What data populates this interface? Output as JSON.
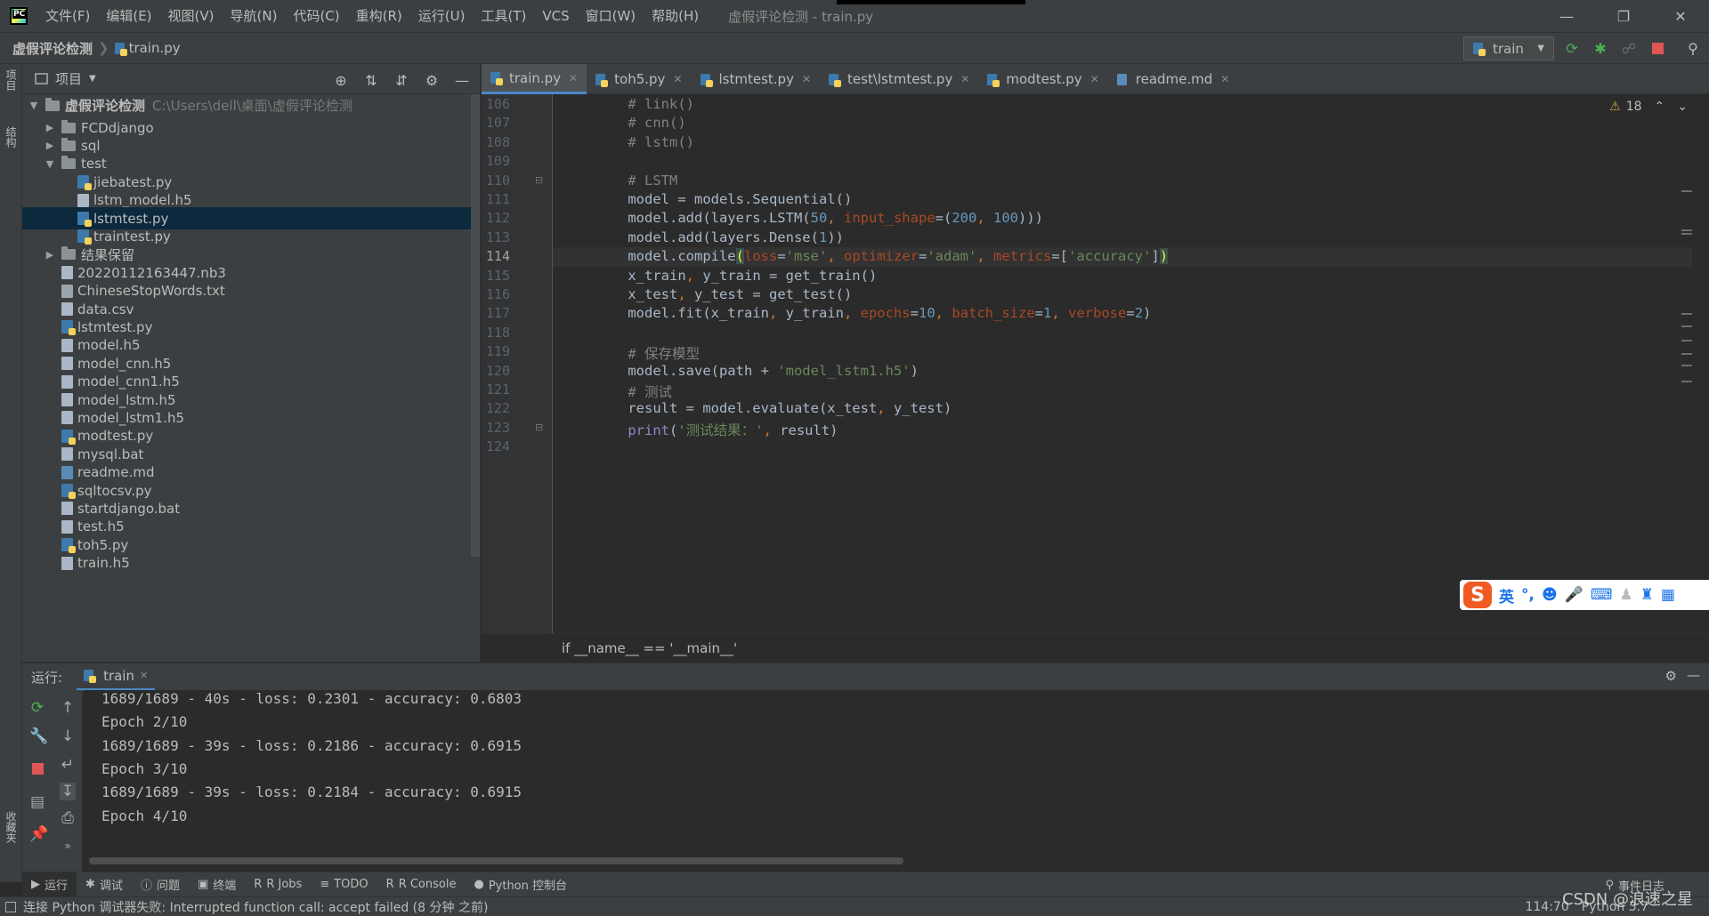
{
  "menubar": {
    "items": [
      "文件(F)",
      "编辑(E)",
      "视图(V)",
      "导航(N)",
      "代码(C)",
      "重构(R)",
      "运行(U)",
      "工具(T)",
      "VCS",
      "窗口(W)",
      "帮助(H)"
    ],
    "window_title": "虚假评论检测 - train.py"
  },
  "navbar": {
    "breadcrumb": [
      "虚假评论检测",
      "train.py"
    ],
    "run_config": "train"
  },
  "left_strip": {
    "project_tab": "项目",
    "structure_tab": "结构",
    "favorites_tab": "收藏夹"
  },
  "project_panel": {
    "title": "项目",
    "root_name": "虚假评论检测",
    "root_path": "C:\\Users\\dell\\桌面\\虚假评论检测",
    "items": [
      {
        "name": "FCDdjango",
        "type": "folder",
        "depth": 1,
        "arrow": "▶"
      },
      {
        "name": "sql",
        "type": "folder",
        "depth": 1,
        "arrow": "▶"
      },
      {
        "name": "test",
        "type": "folder",
        "depth": 1,
        "arrow": "▼"
      },
      {
        "name": "jiebatest.py",
        "type": "py",
        "depth": 2,
        "arrow": ""
      },
      {
        "name": "lstm_model.h5",
        "type": "file",
        "depth": 2,
        "arrow": ""
      },
      {
        "name": "lstmtest.py",
        "type": "py",
        "depth": 2,
        "arrow": "",
        "selected": true
      },
      {
        "name": "traintest.py",
        "type": "py",
        "depth": 2,
        "arrow": ""
      },
      {
        "name": "结果保留",
        "type": "folder",
        "depth": 1,
        "arrow": "▶"
      },
      {
        "name": "20220112163447.nb3",
        "type": "file",
        "depth": 1,
        "arrow": ""
      },
      {
        "name": "ChineseStopWords.txt",
        "type": "txt",
        "depth": 1,
        "arrow": ""
      },
      {
        "name": "data.csv",
        "type": "file",
        "depth": 1,
        "arrow": ""
      },
      {
        "name": "lstmtest.py",
        "type": "py",
        "depth": 1,
        "arrow": ""
      },
      {
        "name": "model.h5",
        "type": "file",
        "depth": 1,
        "arrow": ""
      },
      {
        "name": "model_cnn.h5",
        "type": "file",
        "depth": 1,
        "arrow": ""
      },
      {
        "name": "model_cnn1.h5",
        "type": "file",
        "depth": 1,
        "arrow": ""
      },
      {
        "name": "model_lstm.h5",
        "type": "file",
        "depth": 1,
        "arrow": ""
      },
      {
        "name": "model_lstm1.h5",
        "type": "file",
        "depth": 1,
        "arrow": ""
      },
      {
        "name": "modtest.py",
        "type": "py",
        "depth": 1,
        "arrow": ""
      },
      {
        "name": "mysql.bat",
        "type": "file",
        "depth": 1,
        "arrow": ""
      },
      {
        "name": "readme.md",
        "type": "md",
        "depth": 1,
        "arrow": ""
      },
      {
        "name": "sqltocsv.py",
        "type": "py",
        "depth": 1,
        "arrow": ""
      },
      {
        "name": "startdjango.bat",
        "type": "file",
        "depth": 1,
        "arrow": ""
      },
      {
        "name": "test.h5",
        "type": "file",
        "depth": 1,
        "arrow": ""
      },
      {
        "name": "toh5.py",
        "type": "py",
        "depth": 1,
        "arrow": ""
      },
      {
        "name": "train.h5",
        "type": "file",
        "depth": 1,
        "arrow": ""
      }
    ]
  },
  "editor": {
    "tabs": [
      {
        "label": "train.py",
        "active": true
      },
      {
        "label": "toh5.py",
        "active": false
      },
      {
        "label": "lstmtest.py",
        "active": false
      },
      {
        "label": "test\\lstmtest.py",
        "active": false
      },
      {
        "label": "modtest.py",
        "active": false
      },
      {
        "label": "readme.md",
        "active": false
      }
    ],
    "inspection_count": "18",
    "current_line": 114,
    "lines": [
      {
        "no": "106",
        "tokens": [
          {
            "t": "    # link()",
            "c": "c-comment"
          }
        ]
      },
      {
        "no": "107",
        "tokens": [
          {
            "t": "    # cnn()",
            "c": "c-comment"
          }
        ]
      },
      {
        "no": "108",
        "tokens": [
          {
            "t": "    # lstm()",
            "c": "c-comment"
          }
        ]
      },
      {
        "no": "109",
        "tokens": []
      },
      {
        "no": "110",
        "tokens": [
          {
            "t": "    # LSTM",
            "c": "c-comment"
          }
        ]
      },
      {
        "no": "111",
        "tokens": [
          {
            "t": "    model = models.Sequential()",
            "c": ""
          }
        ]
      },
      {
        "no": "112",
        "tokens": [
          {
            "t": "    model.add(layers.LSTM(",
            "c": ""
          },
          {
            "t": "50",
            "c": "c-num"
          },
          {
            "t": ", ",
            "c": "c-kw"
          },
          {
            "t": "input_shape",
            "c": "c-param"
          },
          {
            "t": "=(",
            "c": ""
          },
          {
            "t": "200",
            "c": "c-num"
          },
          {
            "t": ", ",
            "c": "c-kw"
          },
          {
            "t": "100",
            "c": "c-num"
          },
          {
            "t": ")))",
            "c": ""
          }
        ]
      },
      {
        "no": "113",
        "tokens": [
          {
            "t": "    model.add(layers.Dense(",
            "c": ""
          },
          {
            "t": "1",
            "c": "c-num"
          },
          {
            "t": "))",
            "c": ""
          }
        ]
      },
      {
        "no": "114",
        "tokens": [
          {
            "t": "    model.compile",
            "c": ""
          },
          {
            "t": "(",
            "c": "c-paren-hl"
          },
          {
            "t": "loss",
            "c": "c-param"
          },
          {
            "t": "=",
            "c": ""
          },
          {
            "t": "'mse'",
            "c": "c-str"
          },
          {
            "t": ", ",
            "c": "c-kw"
          },
          {
            "t": "optimizer",
            "c": "c-param"
          },
          {
            "t": "=",
            "c": ""
          },
          {
            "t": "'adam'",
            "c": "c-str"
          },
          {
            "t": ", ",
            "c": "c-kw"
          },
          {
            "t": "metrics",
            "c": "c-param"
          },
          {
            "t": "=[",
            "c": ""
          },
          {
            "t": "'accuracy'",
            "c": "c-str"
          },
          {
            "t": "]",
            "c": ""
          },
          {
            "t": ")",
            "c": "c-paren-hl"
          }
        ]
      },
      {
        "no": "115",
        "tokens": [
          {
            "t": "    x_train",
            "c": ""
          },
          {
            "t": ", ",
            "c": "c-kw"
          },
          {
            "t": "y_train = get_train()",
            "c": ""
          }
        ]
      },
      {
        "no": "116",
        "tokens": [
          {
            "t": "    x_test",
            "c": ""
          },
          {
            "t": ", ",
            "c": "c-kw"
          },
          {
            "t": "y_test = get_test()",
            "c": ""
          }
        ]
      },
      {
        "no": "117",
        "tokens": [
          {
            "t": "    model.fit(x_train",
            "c": ""
          },
          {
            "t": ", ",
            "c": "c-kw"
          },
          {
            "t": "y_train",
            "c": ""
          },
          {
            "t": ", ",
            "c": "c-kw"
          },
          {
            "t": "epochs",
            "c": "c-param"
          },
          {
            "t": "=",
            "c": ""
          },
          {
            "t": "10",
            "c": "c-num"
          },
          {
            "t": ", ",
            "c": "c-kw"
          },
          {
            "t": "batch_size",
            "c": "c-param"
          },
          {
            "t": "=",
            "c": ""
          },
          {
            "t": "1",
            "c": "c-num"
          },
          {
            "t": ", ",
            "c": "c-kw"
          },
          {
            "t": "verbose",
            "c": "c-param"
          },
          {
            "t": "=",
            "c": ""
          },
          {
            "t": "2",
            "c": "c-num"
          },
          {
            "t": ")",
            "c": ""
          }
        ]
      },
      {
        "no": "118",
        "tokens": []
      },
      {
        "no": "119",
        "tokens": [
          {
            "t": "    # 保存模型",
            "c": "c-comment"
          }
        ]
      },
      {
        "no": "120",
        "tokens": [
          {
            "t": "    model.save(path + ",
            "c": ""
          },
          {
            "t": "'model_lstm1.h5'",
            "c": "c-str"
          },
          {
            "t": ")",
            "c": ""
          }
        ]
      },
      {
        "no": "121",
        "tokens": [
          {
            "t": "    # 测试",
            "c": "c-comment"
          }
        ]
      },
      {
        "no": "122",
        "tokens": [
          {
            "t": "    result = model.evaluate(x_test",
            "c": ""
          },
          {
            "t": ", ",
            "c": "c-kw"
          },
          {
            "t": "y_test)",
            "c": ""
          }
        ]
      },
      {
        "no": "123",
        "tokens": [
          {
            "t": "    ",
            "c": ""
          },
          {
            "t": "print",
            "c": "c-builtin"
          },
          {
            "t": "(",
            "c": ""
          },
          {
            "t": "'测试结果：'",
            "c": "c-str"
          },
          {
            "t": ", ",
            "c": "c-kw"
          },
          {
            "t": "result)",
            "c": ""
          }
        ]
      },
      {
        "no": "124",
        "tokens": []
      }
    ],
    "bottom_breadcrumb": "if __name__ == '__main__'"
  },
  "ime": {
    "lang": "英",
    "punct": "°,"
  },
  "run_panel": {
    "label": "运行:",
    "tab": "train",
    "console_lines": [
      "1689/1689 - 40s - loss: 0.2301 - accuracy: 0.6803",
      "Epoch 2/10",
      "1689/1689 - 39s - loss: 0.2186 - accuracy: 0.6915",
      "Epoch 3/10",
      "1689/1689 - 39s - loss: 0.2184 - accuracy: 0.6915",
      "Epoch 4/10"
    ]
  },
  "tool_tabs": {
    "items": [
      "运行",
      "调试",
      "问题",
      "终端",
      "R Jobs",
      "TODO",
      "R Console",
      "Python 控制台"
    ],
    "event_log": "事件日志"
  },
  "statusbar": {
    "message": "连接 Python 调试器失败: Interrupted function call: accept failed (8 分钟 之前)",
    "position": "114:70",
    "interpreter": "Python 3.7",
    "watermark": "CSDN @浪速之星"
  },
  "colors": {
    "accent": "#4a88c7",
    "selection": "#0d293e",
    "run_green": "#4caf50",
    "stop_red": "#e05555"
  }
}
